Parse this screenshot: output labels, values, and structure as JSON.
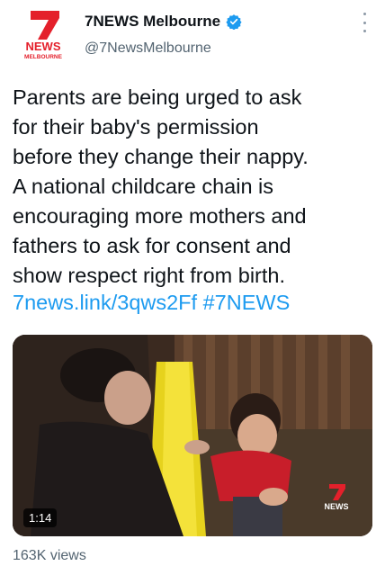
{
  "account": {
    "display_name": "7NEWS Melbourne",
    "handle": "@7NewsMelbourne",
    "logo_text_top": "NEWS",
    "logo_text_bottom": "MELBOURNE",
    "logo_numeral": "7"
  },
  "tweet": {
    "text": "Parents are being urged to ask\nfor their baby's permission\nbefore they change their nappy.\nA national childcare chain is\nencouraging more mothers and\nfathers to ask for consent and\nshow respect right from birth.",
    "link": "7news.link/3qws2Ff",
    "hashtag": "#7NEWS"
  },
  "media": {
    "duration": "1:14",
    "watermark": "NEWS"
  },
  "stats": {
    "views": "163K views"
  },
  "colors": {
    "brand_red": "#e4202b",
    "link_blue": "#1d9bf0",
    "verified_blue": "#1d9bf0"
  }
}
